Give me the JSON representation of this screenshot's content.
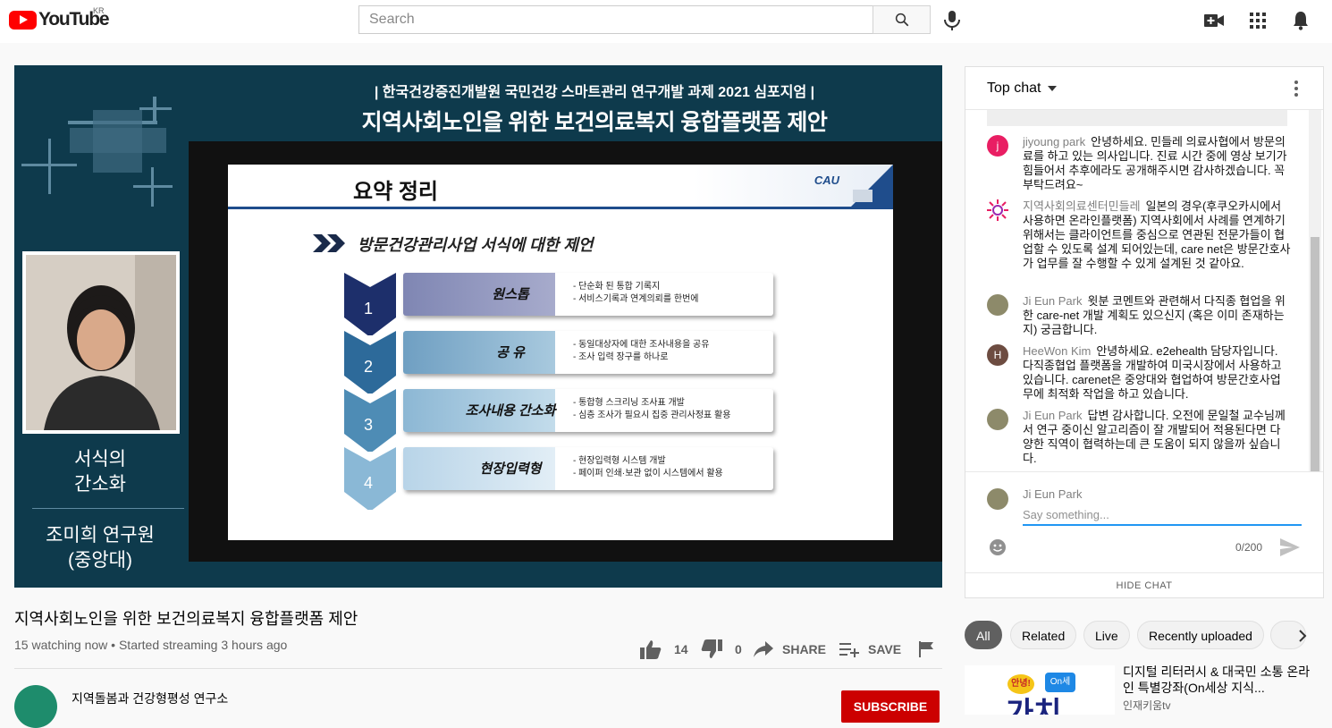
{
  "header": {
    "logo_text": "YouTube",
    "country": "KR",
    "search_placeholder": "Search"
  },
  "player": {
    "slide_header_line1": "| 한국건강증진개발원 국민건강 스마트관리 연구개발 과제 2021 심포지엄 |",
    "slide_header_line2": "지역사회노인을 위한 보건의료복지 융합플랫폼 제안",
    "speaker_topic_line1": "서식의",
    "speaker_topic_line2": "간소화",
    "speaker_name_line1": "조미희 연구원",
    "speaker_name_line2": "(중앙대)",
    "slide": {
      "title": "요약 정리",
      "logo": "CAU",
      "subtitle": "방문건강관리사업 서식에 대한 제언",
      "steps": [
        {
          "num": "1",
          "name": "원스톱",
          "desc1": "- 단순화 된 통합 기록지",
          "desc2": "- 서비스기록과 연계의뢰를 한번에"
        },
        {
          "num": "2",
          "name": "공 유",
          "desc1": "- 동일대상자에 대한 조사내용을 공유",
          "desc2": "- 조사 입력 장구를 하나로"
        },
        {
          "num": "3",
          "name": "조사내용 간소화",
          "desc1": "- 통합형 스크리닝 조사표 개발",
          "desc2": "- 심층 조사가 필요시 집중 관리사정표 활용"
        },
        {
          "num": "4",
          "name": "현장입력형",
          "desc1": "- 현장입력형 시스템 개발",
          "desc2": "- 페이퍼 인쇄·보관 없이 시스템에서 활용"
        }
      ]
    }
  },
  "video": {
    "title": "지역사회노인을 위한 보건의료복지 융합플랫폼 제안",
    "meta": "15 watching now • Started streaming 3 hours ago",
    "likes": "14",
    "dislikes": "0",
    "share_label": "SHARE",
    "save_label": "SAVE"
  },
  "channel": {
    "name": "지역돌봄과 건강형평성 연구소",
    "subscribe_label": "SUBSCRIBE"
  },
  "chat": {
    "mode": "Top chat",
    "messages": [
      {
        "author": "jiyoung park",
        "avatar_letter": "j",
        "avatar_color": "#e91e63",
        "text": "안녕하세요. 민들레 의료사협에서 방문의료를 하고 있는 의사입니다. 진료 시간 중에 영상 보기가 힘들어서 추후에라도 공개해주시면 감사하겠습니다. 꼭 부탁드려요~"
      },
      {
        "author": "지역사회의료센터민들레",
        "avatar_letter": "",
        "avatar_color": "#ffffff",
        "text": "일본의 경우(후쿠오카시에서 사용하면 온라인플랫폼) 지역사회에서 사례를 연계하기 위해서는 클라이언트를 중심으로 연관된 전문가들이 협업할 수 있도록 설계 되어있는데, care net은 방문간호사가 업무를 잘 수행할 수 있게 설계된 것 같아요."
      },
      {
        "author": "Ji Eun Park",
        "avatar_letter": "",
        "avatar_color": "#8d8a6a",
        "text": "윗분 코멘트와 관련해서 다직종 협업을 위한 care-net 개발 계획도 있으신지 (혹은 이미 존재하는지) 궁금합니다."
      },
      {
        "author": "HeeWon Kim",
        "avatar_letter": "H",
        "avatar_color": "#6d4c41",
        "text": "안녕하세요. e2ehealth 담당자입니다. 다직종협업 플랫폼을 개발하여 미국시장에서 사용하고 있습니다. carenet은 중앙대와 협업하여 방문간호사업무에 최적화 작업을 하고 있습니다."
      },
      {
        "author": "Ji Eun Park",
        "avatar_letter": "",
        "avatar_color": "#8d8a6a",
        "text": "답변 감사합니다. 오전에 문일철 교수님께서 연구 중이신 알고리즘이 잘 개발되어 적용된다면 다양한 직역이 협력하는데 큰 도움이 되지 않을까 싶습니다."
      }
    ],
    "input_author": "Ji Eun Park",
    "input_placeholder": "Say something...",
    "char_count": "0/200",
    "hide_label": "HIDE CHAT"
  },
  "chips": [
    "All",
    "Related",
    "Live",
    "Recently uploaded"
  ],
  "recommendation": {
    "title": "디지털 리터러시 & 대국민 소통 온라인 특별강좌(On세상 지식...",
    "channel": "인재키움tv",
    "thumb_badge1": "안녕!",
    "thumb_badge2": "On세",
    "thumb_text": "가치"
  }
}
